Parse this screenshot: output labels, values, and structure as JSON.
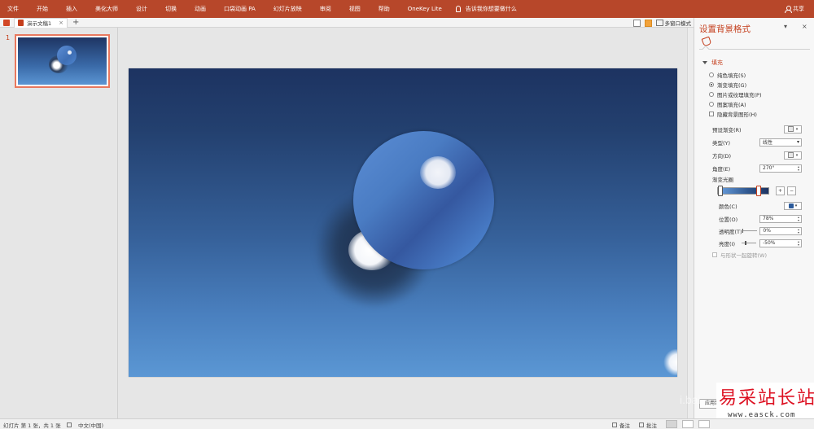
{
  "ribbon": {
    "tabs": [
      "文件",
      "开始",
      "插入",
      "美化大师",
      "设计",
      "切换",
      "动画",
      "口袋动画 PA",
      "幻灯片放映",
      "审阅",
      "视图",
      "帮助",
      "OneKey Lite"
    ],
    "tell_me": "告诉我你想要做什么",
    "share": "共享"
  },
  "doc_tabs": {
    "tab_label": "演示文稿1",
    "close": "×",
    "new_tab": "+",
    "multi_window": "多窗口模式"
  },
  "thumbnails": {
    "slide_number": "1"
  },
  "format_pane": {
    "title": "设置背景格式",
    "section": "填充",
    "fill_options": [
      {
        "label": "纯色填充(S)",
        "selected": false
      },
      {
        "label": "渐变填充(G)",
        "selected": true
      },
      {
        "label": "图片或纹理填充(P)",
        "selected": false
      },
      {
        "label": "图案填充(A)",
        "selected": false
      }
    ],
    "hide_graphics": "隐藏背景图形(H)",
    "preset_label": "预设渐变(R)",
    "type_label": "类型(Y)",
    "type_value": "线性",
    "direction_label": "方向(D)",
    "angle_label": "角度(E)",
    "angle_value": "270°",
    "stops_label": "渐变光圈",
    "color_label": "颜色(C)",
    "position_label": "位置(O)",
    "position_value": "78%",
    "transparency_label": "透明度(T)",
    "transparency_value": "0%",
    "brightness_label": "亮度(I)",
    "brightness_value": "-50%",
    "rotate_with_shape": "与形状一起旋转(W)",
    "apply_button": "应用到"
  },
  "watermark": {
    "brand": "易采站长站",
    "url": "www.easck.com",
    "faint": "i.bai"
  },
  "status_bar": {
    "slide_info": "幻灯片 第 1 张，共 1 张",
    "language": "中文(中国)",
    "notes": "备注",
    "comments": "批注"
  },
  "colors": {
    "accent": "#b7472a",
    "pane_accent": "#c43e1c",
    "slide_top": "#1d3361",
    "slide_bottom": "#5b97d4"
  }
}
